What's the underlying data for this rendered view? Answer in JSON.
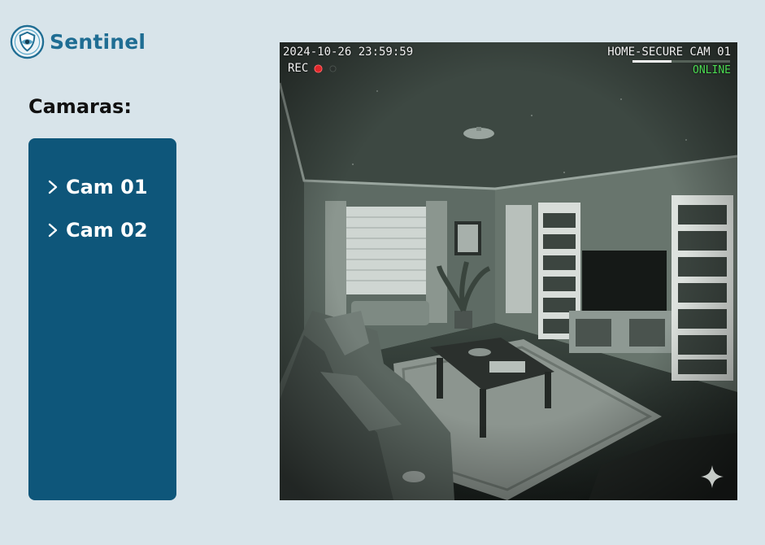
{
  "brand": {
    "name": "Sentinel",
    "logo_icon": "shield-eye-icon",
    "color": "#1f6d93"
  },
  "sidebar": {
    "title": "Camaras:",
    "panel_color": "#0e567a",
    "cameras": [
      {
        "label": "Cam 01",
        "icon": "chevron-right-icon"
      },
      {
        "label": "Cam 02",
        "icon": "chevron-right-icon"
      }
    ]
  },
  "feed": {
    "timestamp": "2024-10-26 23:59:59",
    "rec_label": "REC",
    "rec_color": "#e0262a",
    "camera_name": "HOME-SECURE CAM 01",
    "signal_level": 0.4,
    "status": "ONLINE",
    "status_color": "#4cdc53",
    "watermark_icon": "sparkle-icon"
  }
}
